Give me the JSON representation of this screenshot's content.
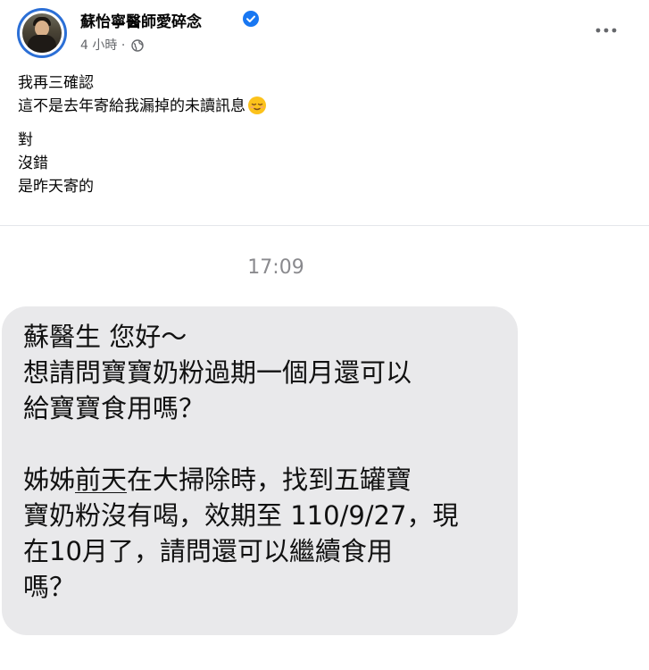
{
  "post": {
    "author": "蘇怡寧醫師愛碎念",
    "time_ago": "4 小時",
    "separator": "·",
    "lines": [
      "我再三確認",
      "這不是去年寄給我漏掉的未讀訊息",
      "對",
      "沒錯",
      "是昨天寄的"
    ],
    "icons": {
      "verified": "verified-badge-icon",
      "privacy": "globe-icon",
      "more": "more-options-icon",
      "emoji": "relieved-face-emoji"
    }
  },
  "message": {
    "timestamp": "17:09",
    "greeting": "蘇醫生 您好～",
    "q_line1": "想請問寶寶奶粉過期一個月還可以",
    "q_line2": "給寶寶食用嗎？",
    "p2_line1_before": "姊姊",
    "p2_line1_underlined": "前天",
    "p2_line1_after": "在大掃除時，找到五罐寶",
    "p2_line2": "寶奶粉沒有喝，效期至 110/9/27，現",
    "p2_line3": "在10月了，請問還可以繼續食用",
    "p2_line4": "嗎？"
  },
  "colors": {
    "verified_blue": "#1877f2",
    "meta_gray": "#65676b",
    "bubble_gray": "#e9e9eb"
  }
}
